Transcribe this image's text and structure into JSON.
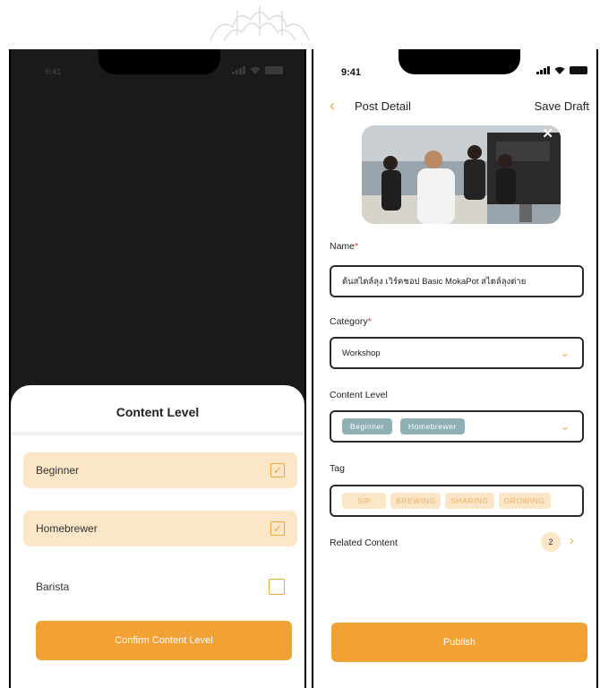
{
  "colors": {
    "accent": "#f2a134",
    "selected_bg": "#fbe6c8",
    "pill_teal": "#8fb0b5"
  },
  "left_screen": {
    "status_time": "9:41",
    "sheet_title": "Content Level",
    "options": [
      {
        "label": "Beginner",
        "checked": true
      },
      {
        "label": "Homebrewer",
        "checked": true
      },
      {
        "label": "Barista",
        "checked": false
      }
    ],
    "confirm_label": "Confirm Content Level"
  },
  "right_screen": {
    "status_time": "9:41",
    "nav": {
      "title": "Post Detail",
      "save_draft": "Save Draft"
    },
    "name_label": "Name",
    "name_value": "ต้นสไตล์ลุง เวิร์คชอป Basic MokaPot สไตล์ลุงต่าย",
    "category_label": "Category",
    "category_value": "Workshop",
    "content_level_label": "Content Level",
    "content_level_pills": [
      "Beginner",
      "Homebrewer"
    ],
    "tag_label": "Tag",
    "tags": [
      "SIP",
      "BREWING",
      "SHARING",
      "GROWING"
    ],
    "related_label": "Related Content",
    "related_count": "2",
    "publish_label": "Publish",
    "required_mark": "*"
  }
}
